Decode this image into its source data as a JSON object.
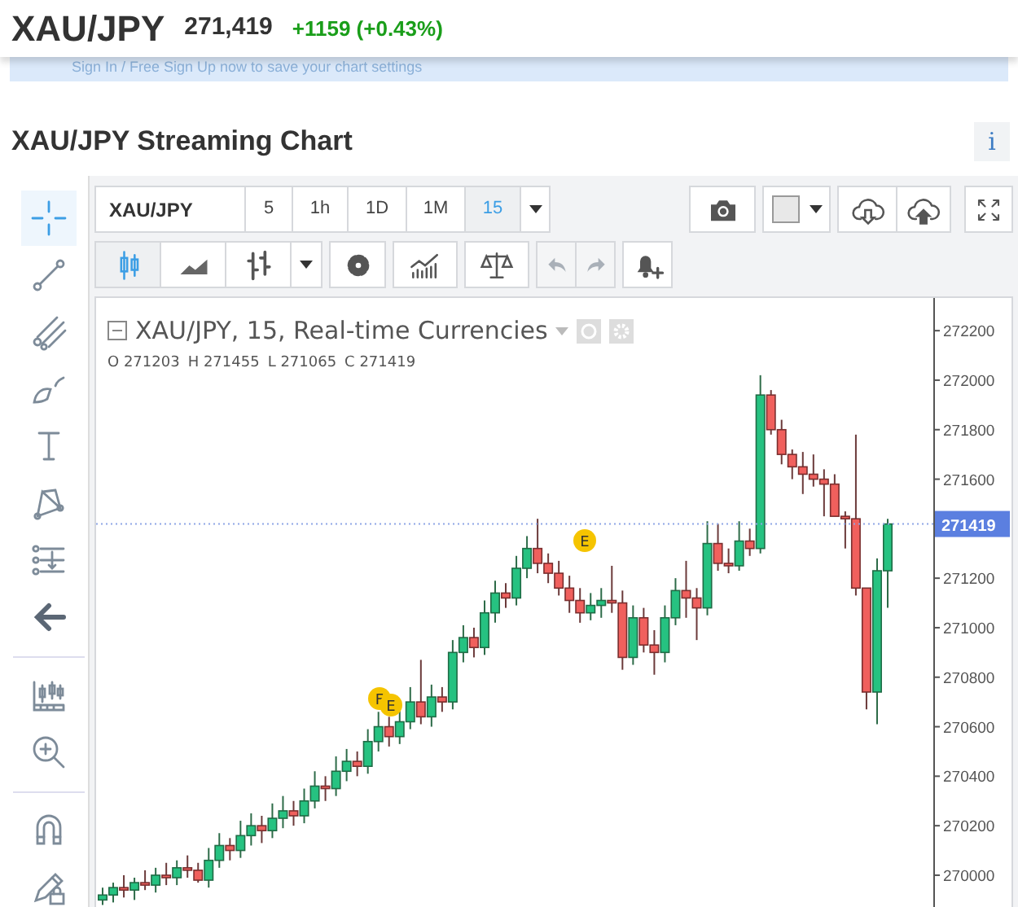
{
  "header": {
    "symbol": "XAU/JPY",
    "price": "271,419",
    "change": "+1159 (+0.43%)"
  },
  "banner": {
    "text": "Sign In / Free Sign Up now to save your chart settings"
  },
  "section": {
    "title": "XAU/JPY Streaming Chart",
    "info_button": "i"
  },
  "drawing_tools": [
    {
      "selected": true
    },
    {
      "selected": false
    },
    {
      "selected": false
    },
    {
      "selected": false
    },
    {
      "selected": false
    },
    {
      "selected": false
    },
    {
      "selected": false
    },
    {
      "selected": false
    },
    {
      "selected": false
    },
    {
      "selected": false
    },
    {
      "selected": false
    },
    {
      "selected": false
    }
  ],
  "toolbar": {
    "symbol": "XAU/JPY",
    "intervals": [
      {
        "label": "5",
        "selected": false
      },
      {
        "label": "1h",
        "selected": false
      },
      {
        "label": "1D",
        "selected": false
      },
      {
        "label": "1M",
        "selected": false
      },
      {
        "label": "15",
        "selected": true
      }
    ],
    "chart_types": [
      {
        "selected": true
      },
      {
        "selected": false
      },
      {
        "selected": false
      }
    ],
    "history": [
      {
        "disabled": true
      },
      {
        "disabled": true
      }
    ]
  },
  "legend": {
    "title": "XAU/JPY, 15, Real-time Currencies",
    "ohlc": [
      "O 271203",
      "H 271455",
      "L 271065",
      "C 271419"
    ]
  },
  "markers": [
    {
      "label": "F"
    },
    {
      "label": "E"
    },
    {
      "label": "E"
    }
  ],
  "chart_data": {
    "type": "candlestick",
    "ylim": [
      269865,
      272332
    ],
    "ref_lines": [
      {
        "axis": "y",
        "value": 271419
      }
    ],
    "yticks": [
      272200,
      272000,
      271800,
      271600,
      271200,
      271000,
      270800,
      270600,
      270400,
      270200,
      270000
    ],
    "ohlc": [
      [
        269900,
        269950,
        269880,
        269920
      ],
      [
        269920,
        269970,
        269890,
        269950
      ],
      [
        269950,
        270000,
        269910,
        269940
      ],
      [
        269940,
        269990,
        269900,
        269970
      ],
      [
        269970,
        270020,
        269940,
        269960
      ],
      [
        269960,
        270030,
        269930,
        270000
      ],
      [
        270000,
        270050,
        269960,
        269990
      ],
      [
        269990,
        270060,
        269960,
        270030
      ],
      [
        270030,
        270080,
        269990,
        270020
      ],
      [
        270020,
        270050,
        269970,
        269980
      ],
      [
        269980,
        270110,
        269950,
        270060
      ],
      [
        270060,
        270170,
        270030,
        270120
      ],
      [
        270120,
        270150,
        270060,
        270100
      ],
      [
        270100,
        270220,
        270070,
        270160
      ],
      [
        270160,
        270250,
        270120,
        270200
      ],
      [
        270200,
        270240,
        270130,
        270180
      ],
      [
        270180,
        270290,
        270150,
        270230
      ],
      [
        270230,
        270320,
        270190,
        270260
      ],
      [
        270260,
        270300,
        270200,
        270240
      ],
      [
        270240,
        270350,
        270210,
        270300
      ],
      [
        270300,
        270420,
        270270,
        270360
      ],
      [
        270360,
        270400,
        270300,
        270350
      ],
      [
        270350,
        270480,
        270320,
        270420
      ],
      [
        270420,
        270510,
        270380,
        270460
      ],
      [
        270460,
        270500,
        270400,
        270440
      ],
      [
        270440,
        270590,
        270410,
        270540
      ],
      [
        270540,
        270660,
        270500,
        270600
      ],
      [
        270600,
        270640,
        270520,
        270560
      ],
      [
        270560,
        270670,
        270530,
        270620
      ],
      [
        270620,
        270760,
        270590,
        270700
      ],
      [
        270700,
        270870,
        270610,
        270640
      ],
      [
        270640,
        270770,
        270600,
        270720
      ],
      [
        270720,
        270760,
        270660,
        270700
      ],
      [
        270700,
        270950,
        270670,
        270900
      ],
      [
        270900,
        271010,
        270860,
        270960
      ],
      [
        270960,
        271000,
        270880,
        270920
      ],
      [
        270920,
        271110,
        270890,
        271060
      ],
      [
        271060,
        271190,
        271020,
        271140
      ],
      [
        271140,
        271180,
        271080,
        271120
      ],
      [
        271120,
        271290,
        271090,
        271240
      ],
      [
        271240,
        271370,
        271200,
        271320
      ],
      [
        271320,
        271440,
        271220,
        271260
      ],
      [
        271260,
        271300,
        271180,
        271220
      ],
      [
        271220,
        271270,
        271130,
        271160
      ],
      [
        271160,
        271210,
        271060,
        271110
      ],
      [
        271110,
        271160,
        271020,
        271060
      ],
      [
        271060,
        271140,
        271030,
        271090
      ],
      [
        271090,
        271160,
        271040,
        271110
      ],
      [
        271110,
        271250,
        271060,
        271100
      ],
      [
        271100,
        271150,
        270830,
        270880
      ],
      [
        270880,
        271090,
        270850,
        271040
      ],
      [
        271040,
        271080,
        270900,
        270930
      ],
      [
        270930,
        270990,
        270810,
        270900
      ],
      [
        270900,
        271090,
        270860,
        271040
      ],
      [
        271040,
        271200,
        271010,
        271150
      ],
      [
        271150,
        271270,
        271040,
        271120
      ],
      [
        271120,
        271160,
        270950,
        271080
      ],
      [
        271080,
        271430,
        271050,
        271340
      ],
      [
        271340,
        271420,
        271230,
        271260
      ],
      [
        271260,
        271320,
        271220,
        271250
      ],
      [
        271250,
        271430,
        271230,
        271350
      ],
      [
        271350,
        271400,
        271290,
        271320
      ],
      [
        271320,
        272020,
        271300,
        271940
      ],
      [
        271940,
        271960,
        271780,
        271800
      ],
      [
        271800,
        271840,
        271660,
        271700
      ],
      [
        271700,
        271720,
        271600,
        271650
      ],
      [
        271650,
        271710,
        271540,
        271620
      ],
      [
        271620,
        271700,
        271570,
        271600
      ],
      [
        271600,
        271640,
        271450,
        271580
      ],
      [
        271580,
        271620,
        271450,
        271450
      ],
      [
        271450,
        271470,
        271320,
        271440
      ],
      [
        271440,
        271780,
        271130,
        271160
      ],
      [
        271160,
        271160,
        270670,
        270740
      ],
      [
        270740,
        271280,
        270610,
        271230
      ],
      [
        271230,
        271440,
        271080,
        271419
      ]
    ]
  },
  "price_axis": {
    "last_price": "271419"
  }
}
